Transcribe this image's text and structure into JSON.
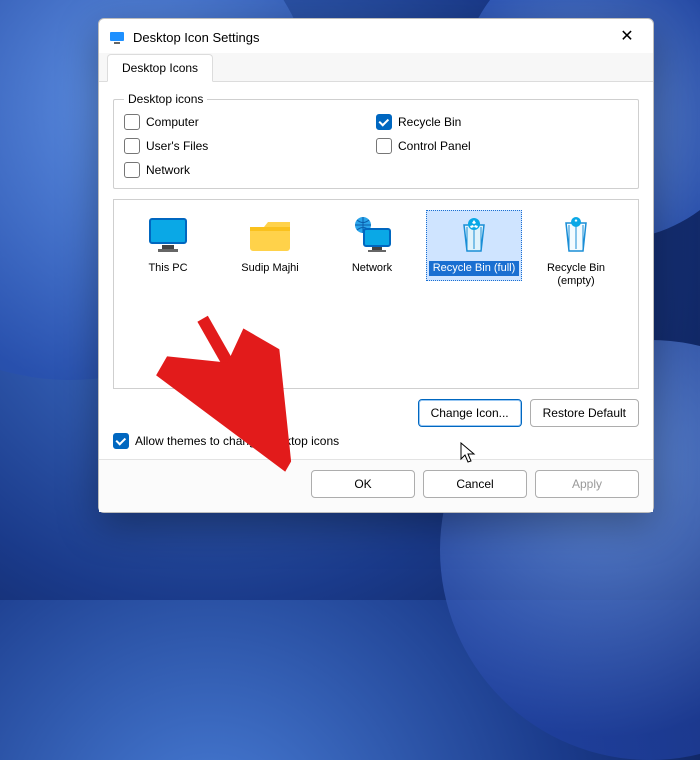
{
  "window": {
    "title": "Desktop Icon Settings"
  },
  "tab": {
    "label": "Desktop Icons"
  },
  "group": {
    "legend": "Desktop icons"
  },
  "checkboxes": {
    "computer": {
      "label": "Computer",
      "checked": false
    },
    "recycle_bin": {
      "label": "Recycle Bin",
      "checked": true
    },
    "users_files": {
      "label": "User's Files",
      "checked": false
    },
    "control_panel": {
      "label": "Control Panel",
      "checked": false
    },
    "network": {
      "label": "Network",
      "checked": false
    }
  },
  "icons": [
    {
      "label": "This PC",
      "kind": "monitor",
      "selected": false
    },
    {
      "label": "Sudip Majhi",
      "kind": "folder",
      "selected": false
    },
    {
      "label": "Network",
      "kind": "netmon",
      "selected": false
    },
    {
      "label": "Recycle Bin (full)",
      "kind": "bin-full",
      "selected": true
    },
    {
      "label": "Recycle Bin (empty)",
      "kind": "bin-empty",
      "selected": false
    }
  ],
  "buttons": {
    "change_icon": "Change Icon...",
    "restore_default": "Restore Default",
    "ok": "OK",
    "cancel": "Cancel",
    "apply": "Apply"
  },
  "allow_themes": {
    "label": "Allow themes to change desktop icons",
    "checked": true
  },
  "colors": {
    "accent": "#0067c0",
    "arrow": "#e21b1b"
  }
}
